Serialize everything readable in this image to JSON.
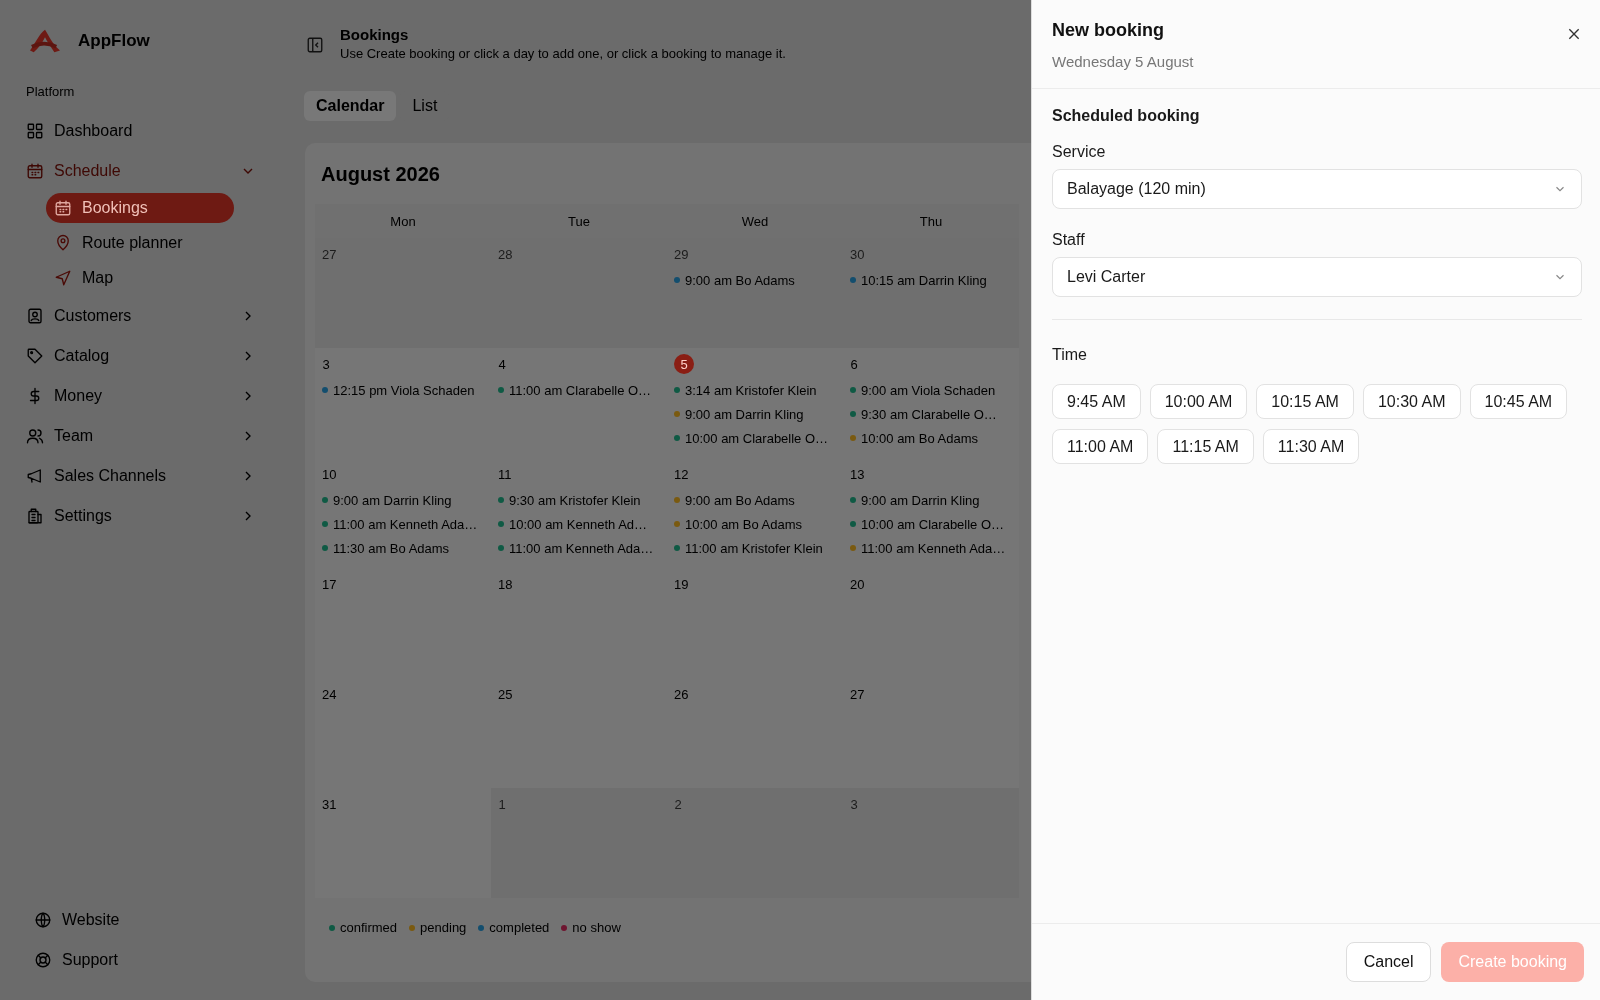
{
  "app": {
    "name": "AppFlow"
  },
  "sidebar": {
    "section": "Platform",
    "items": [
      {
        "label": "Dashboard",
        "kind": "link",
        "selected": false
      },
      {
        "label": "Schedule",
        "kind": "group",
        "selected": true,
        "expanded": true,
        "children": [
          {
            "label": "Bookings",
            "selected": true
          },
          {
            "label": "Route planner",
            "selected": false
          },
          {
            "label": "Map",
            "selected": false
          }
        ]
      },
      {
        "label": "Customers",
        "kind": "group",
        "selected": false,
        "expanded": false
      },
      {
        "label": "Catalog",
        "kind": "group",
        "selected": false,
        "expanded": false
      },
      {
        "label": "Money",
        "kind": "group",
        "selected": false,
        "expanded": false
      },
      {
        "label": "Team",
        "kind": "group",
        "selected": false,
        "expanded": false
      },
      {
        "label": "Sales Channels",
        "kind": "group",
        "selected": false,
        "expanded": false
      },
      {
        "label": "Settings",
        "kind": "group",
        "selected": false,
        "expanded": false
      }
    ],
    "footer": [
      "Website",
      "Support"
    ]
  },
  "header": {
    "title": "Bookings",
    "subtitle": "Use Create booking or click a day to add one, or click a booking to manage it."
  },
  "tabs": [
    {
      "label": "Calendar",
      "selected": true
    },
    {
      "label": "List",
      "selected": false
    }
  ],
  "calendar": {
    "title": "August 2026",
    "weekdays": [
      "Mon",
      "Tue",
      "Wed",
      "Thu"
    ],
    "weeks": [
      [
        {
          "date": "27",
          "muted": true,
          "today": false
        },
        {
          "date": "28",
          "muted": true,
          "today": false
        },
        {
          "date": "29",
          "muted": true,
          "today": false,
          "events": [
            {
              "text": "9:00 am Bo Adams",
              "color": "#134e6e"
            }
          ]
        },
        {
          "date": "30",
          "muted": true,
          "today": false,
          "events": [
            {
              "text": "10:15 am Darrin Kling",
              "color": "#134e6e"
            }
          ]
        }
      ],
      [
        {
          "date": "3",
          "muted": false,
          "today": false,
          "events": [
            {
              "text": "12:15 pm Viola Schaden",
              "color": "#134e6e"
            }
          ]
        },
        {
          "date": "4",
          "muted": false,
          "today": false,
          "events": [
            {
              "text": "11:00 am Clarabelle O…",
              "color": "#0f5a44"
            }
          ]
        },
        {
          "date": "5",
          "muted": false,
          "today": true,
          "events": [
            {
              "text": "3:14 am Kristofer Klein",
              "color": "#0f5a44"
            },
            {
              "text": "9:00 am Darrin Kling",
              "color": "#7a5a10"
            },
            {
              "text": "10:00 am Clarabelle O…",
              "color": "#0f5a44"
            }
          ]
        },
        {
          "date": "6",
          "muted": false,
          "today": false,
          "events": [
            {
              "text": "9:00 am Viola Schaden",
              "color": "#0f5a44"
            },
            {
              "text": "9:30 am Clarabelle O…",
              "color": "#0f5a44"
            },
            {
              "text": "10:00 am Bo Adams",
              "color": "#7a5a10"
            }
          ]
        }
      ],
      [
        {
          "date": "10",
          "muted": false,
          "today": false,
          "events": [
            {
              "text": "9:00 am Darrin Kling",
              "color": "#0f5a44"
            },
            {
              "text": "11:00 am Kenneth Ada…",
              "color": "#0f5a44"
            },
            {
              "text": "11:30 am Bo Adams",
              "color": "#0f5a44"
            }
          ]
        },
        {
          "date": "11",
          "muted": false,
          "today": false,
          "events": [
            {
              "text": "9:30 am Kristofer Klein",
              "color": "#0f5a44"
            },
            {
              "text": "10:00 am Kenneth Ad…",
              "color": "#0f5a44"
            },
            {
              "text": "11:00 am Kenneth Ada…",
              "color": "#0f5a44"
            }
          ]
        },
        {
          "date": "12",
          "muted": false,
          "today": false,
          "events": [
            {
              "text": "9:00 am Bo Adams",
              "color": "#7a5a10"
            },
            {
              "text": "10:00 am Bo Adams",
              "color": "#7a5a10"
            },
            {
              "text": "11:00 am Kristofer Klein",
              "color": "#0f5a44"
            }
          ]
        },
        {
          "date": "13",
          "muted": false,
          "today": false,
          "events": [
            {
              "text": "9:00 am Darrin Kling",
              "color": "#0f5a44"
            },
            {
              "text": "10:00 am Clarabelle O…",
              "color": "#0f5a44"
            },
            {
              "text": "11:00 am Kenneth Ada…",
              "color": "#7a5a10"
            }
          ]
        }
      ],
      [
        {
          "date": "17",
          "muted": false,
          "today": false
        },
        {
          "date": "18",
          "muted": false,
          "today": false
        },
        {
          "date": "19",
          "muted": false,
          "today": false
        },
        {
          "date": "20",
          "muted": false,
          "today": false
        }
      ],
      [
        {
          "date": "24",
          "muted": false,
          "today": false
        },
        {
          "date": "25",
          "muted": false,
          "today": false
        },
        {
          "date": "26",
          "muted": false,
          "today": false
        },
        {
          "date": "27",
          "muted": false,
          "today": false
        }
      ],
      [
        {
          "date": "31",
          "muted": false,
          "today": false
        },
        {
          "date": "1",
          "muted": true,
          "today": false
        },
        {
          "date": "2",
          "muted": true,
          "today": false
        },
        {
          "date": "3",
          "muted": true,
          "today": false
        }
      ]
    ],
    "legend": [
      {
        "label": "confirmed",
        "color": "#0f5a44"
      },
      {
        "label": "pending",
        "color": "#7a5a10"
      },
      {
        "label": "completed",
        "color": "#134e6e"
      },
      {
        "label": "no show",
        "color": "#6e1530"
      }
    ]
  },
  "drawer": {
    "title": "New booking",
    "subtitle": "Wednesday 5 August",
    "section": "Scheduled booking",
    "fields": [
      {
        "label": "Service",
        "value": "Balayage (120 min)"
      },
      {
        "label": "Staff",
        "value": "Levi Carter"
      }
    ],
    "time_label": "Time",
    "times": [
      {
        "label": "9:45 AM",
        "selected": false
      },
      {
        "label": "10:00 AM",
        "selected": false
      },
      {
        "label": "10:15 AM",
        "selected": false
      },
      {
        "label": "10:30 AM",
        "selected": false
      },
      {
        "label": "10:45 AM",
        "selected": false
      },
      {
        "label": "11:00 AM",
        "selected": false
      },
      {
        "label": "11:15 AM",
        "selected": false
      },
      {
        "label": "11:30 AM",
        "selected": false
      }
    ],
    "buttons": [
      {
        "label": "Cancel",
        "kind": "secondary",
        "disabled": false
      },
      {
        "label": "Create booking",
        "kind": "primary",
        "disabled": true
      }
    ]
  }
}
